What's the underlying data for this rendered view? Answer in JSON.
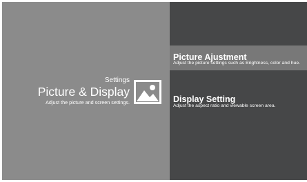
{
  "header": {
    "category": "Settings",
    "title": "Picture & Display",
    "subtitle": "Adjust the picture and screen settings.",
    "icon": "picture-landscape-icon"
  },
  "menu": {
    "items": [
      {
        "label": "Picture Ajustment",
        "description": "Adjust the picture settings such as Brightness, color and hue.",
        "selected": true
      },
      {
        "label": "Display Setting",
        "description": "Adjust the aspect ratio and viewable screen area.",
        "selected": false
      }
    ]
  },
  "colors": {
    "left_panel": "#8b8b8b",
    "right_panel": "#464748",
    "highlight": "#787878",
    "text": "#ffffff"
  }
}
